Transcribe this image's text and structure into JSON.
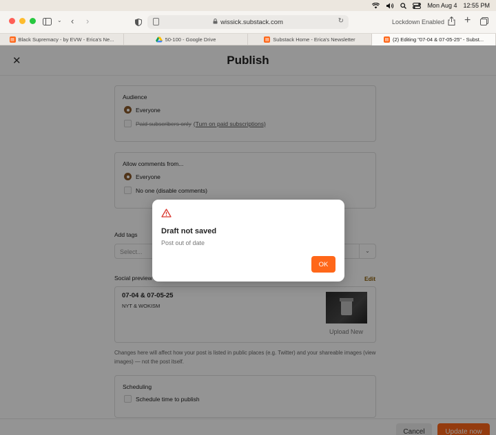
{
  "menubar": {
    "date": "Mon Aug 4",
    "time": "12:55 PM"
  },
  "browser": {
    "address": "wissick.substack.com",
    "lockdown": "Lockdown Enabled",
    "tabs": [
      {
        "label": "Black Supremacy - by EVW - Erica's Ne..."
      },
      {
        "label": "50-100 - Google Drive"
      },
      {
        "label": "Substack Home - Erica's Newsletter"
      },
      {
        "label": "(2) Editing \"07-04 & 07-05-25\" - Subst..."
      }
    ]
  },
  "page": {
    "title": "Publish",
    "audience": {
      "title": "Audience",
      "everyone": "Everyone",
      "paid_only": "Paid subscribers only",
      "turn_on_paid": "(Turn on paid subscriptions)"
    },
    "comments": {
      "title": "Allow comments from...",
      "everyone": "Everyone",
      "no_one": "No one (disable comments)"
    },
    "tags": {
      "label": "Add tags",
      "placeholder": "Select..."
    },
    "social_preview": {
      "label": "Social preview",
      "edit": "Edit",
      "post_title": "07-04 & 07-05-25",
      "post_subtitle": "NYT & WOKISM",
      "upload_new": "Upload New",
      "help_text": "Changes here will affect how your post is listed in public places (e.g. Twitter) and your shareable images (view images) — not the post itself."
    },
    "scheduling": {
      "title": "Scheduling",
      "option": "Schedule time to publish"
    },
    "footer": {
      "cancel": "Cancel",
      "update": "Update now"
    }
  },
  "dialog": {
    "title": "Draft not saved",
    "message": "Post out of date",
    "ok": "OK"
  },
  "colors": {
    "accent": "#ff6719",
    "radio": "#8a5a2b",
    "warning": "#d9342b"
  }
}
